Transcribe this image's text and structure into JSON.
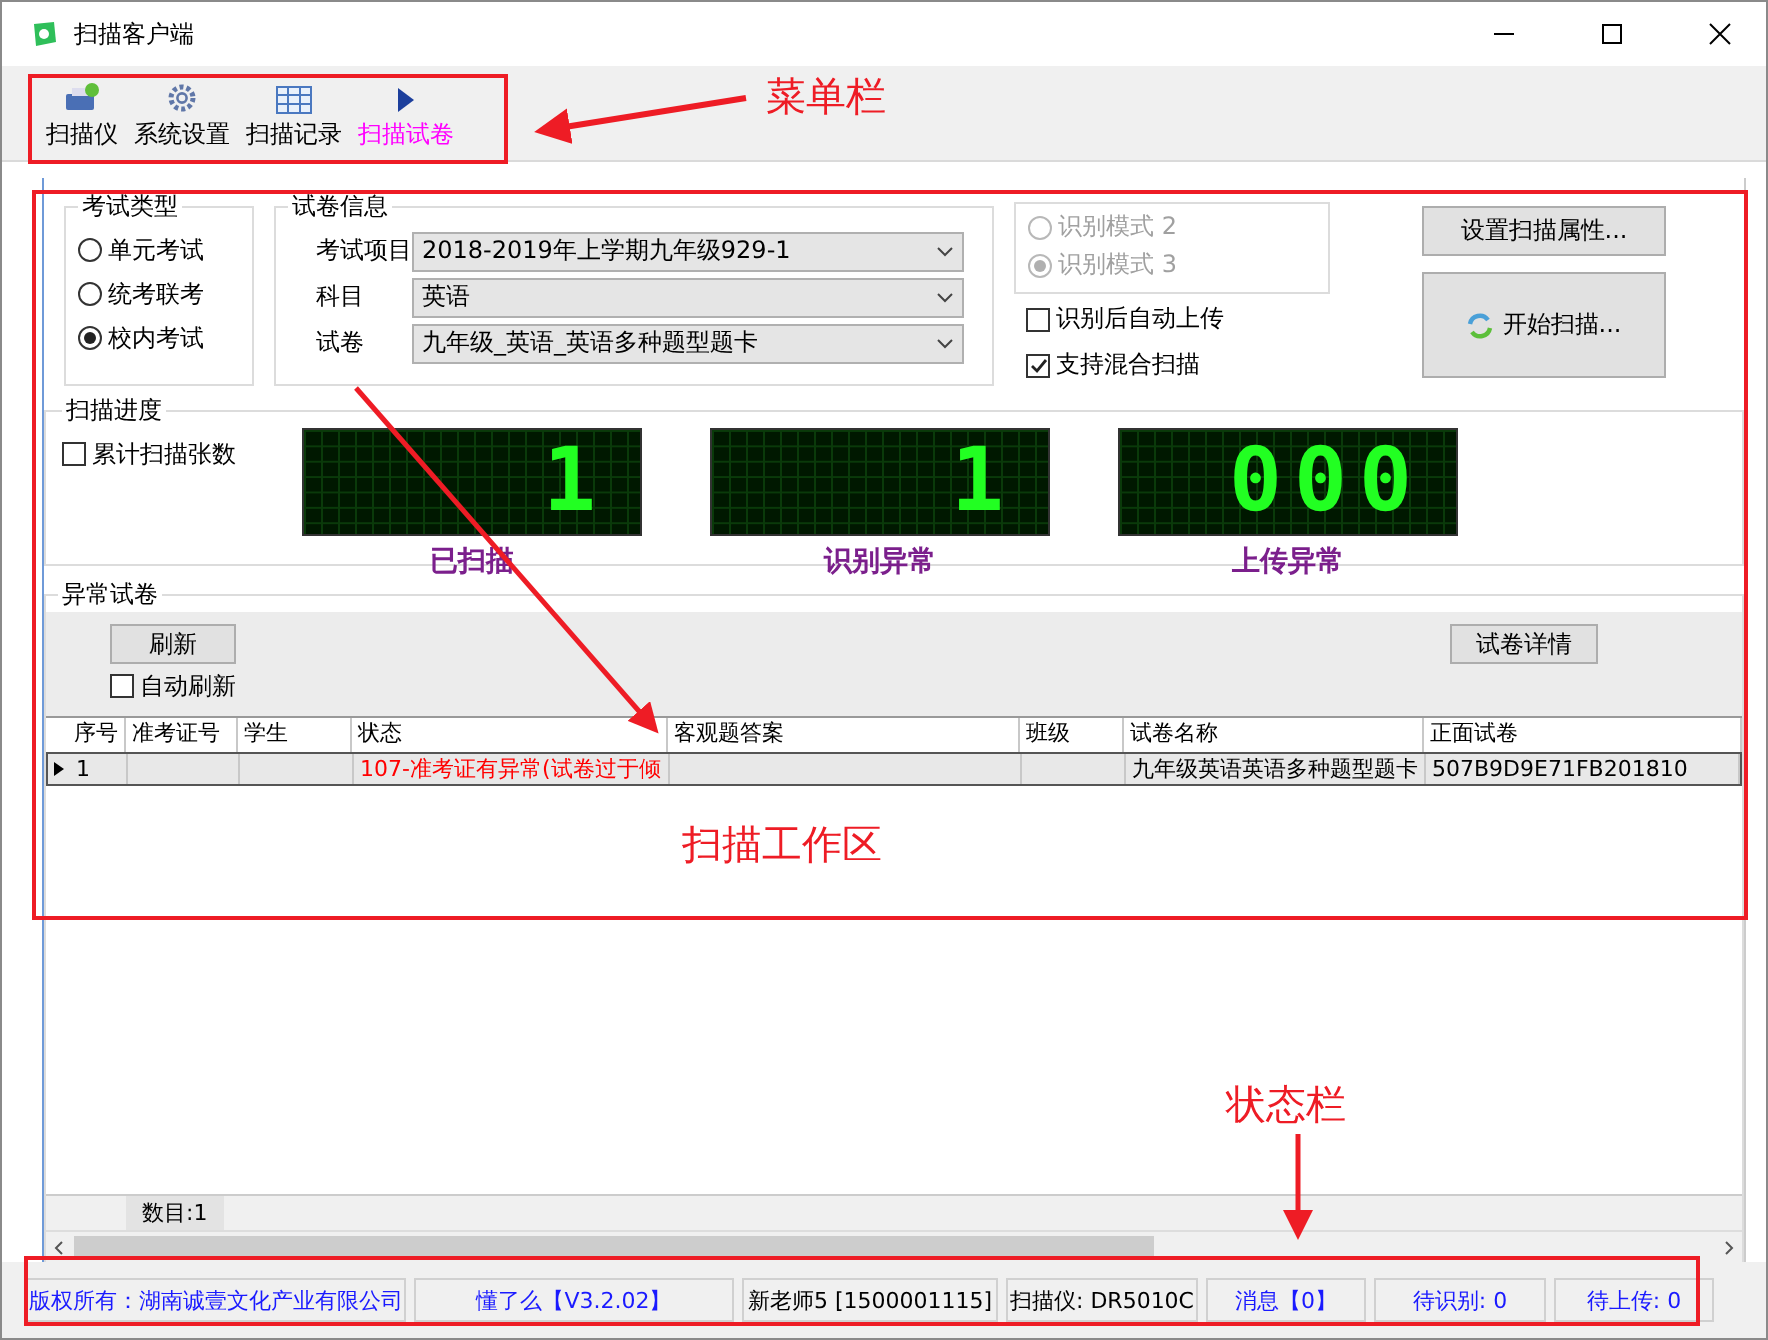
{
  "window": {
    "title": "扫描客户端"
  },
  "toolbar": {
    "items": [
      {
        "label": "扫描仪",
        "selected": false
      },
      {
        "label": "系统设置",
        "selected": false
      },
      {
        "label": "扫描记录",
        "selected": false
      },
      {
        "label": "扫描试卷",
        "selected": true
      }
    ]
  },
  "exam_type": {
    "title": "考试类型",
    "options": [
      {
        "label": "单元考试",
        "selected": false
      },
      {
        "label": "统考联考",
        "selected": false
      },
      {
        "label": "校内考试",
        "selected": true
      }
    ]
  },
  "paper_info": {
    "title": "试卷信息",
    "fields": [
      {
        "label": "考试项目",
        "value": "2018-2019年上学期九年级929-1"
      },
      {
        "label": "科目",
        "value": "英语"
      },
      {
        "label": "试卷",
        "value": "九年级_英语_英语多种题型题卡"
      }
    ]
  },
  "recognition_modes": {
    "disabled": true,
    "options": [
      {
        "label": "识别模式 2",
        "selected": false
      },
      {
        "label": "识别模式 3",
        "selected": true
      }
    ]
  },
  "options": [
    {
      "label": "识别后自动上传",
      "checked": false
    },
    {
      "label": "支持混合扫描",
      "checked": true
    }
  ],
  "buttons": [
    "设置扫描属性...",
    "开始扫描..."
  ],
  "progress": {
    "title": "扫描进度",
    "cumulative": {
      "label": "累计扫描张数",
      "checked": false
    },
    "counters": [
      {
        "value": "1",
        "label": "已扫描"
      },
      {
        "value": "1",
        "label": "识别异常"
      },
      {
        "value": "000",
        "label": "上传异常"
      }
    ]
  },
  "abnormal": {
    "title": "异常试卷",
    "refresh": "刷新",
    "auto_refresh": {
      "label": "自动刷新",
      "checked": false
    },
    "details": "试卷详情",
    "table": {
      "columns": [
        "序号",
        "准考证号",
        "学生",
        "状态",
        "客观题答案",
        "班级",
        "试卷名称",
        "正面试卷"
      ],
      "rows": [
        {
          "selected": true,
          "cells": [
            "1",
            "",
            "",
            "107-准考证有异常(试卷过于倾",
            "",
            "",
            "九年级英语英语多种题型题卡",
            "507B9D9E71FB201810"
          ]
        }
      ]
    },
    "count": "数目:1"
  },
  "status_bar": [
    {
      "text": "版权所有：湖南诚壹文化产业有限公司",
      "color": "#1a1aff"
    },
    {
      "text": "懂了么【V3.2.02】",
      "color": "#1a1aff"
    },
    {
      "text": "新老师5 [1500001115]",
      "color": "#000000"
    },
    {
      "text": "扫描仪: DR5010C",
      "color": "#000000"
    },
    {
      "text": "消息【0】",
      "color": "#1a1aff"
    },
    {
      "text": "待识别: 0",
      "color": "#1a1aff"
    },
    {
      "text": "待上传: 0",
      "color": "#1a1aff"
    }
  ],
  "annotations": [
    {
      "label": "菜单栏"
    },
    {
      "label": "扫描工作区"
    },
    {
      "label": "状态栏"
    }
  ]
}
